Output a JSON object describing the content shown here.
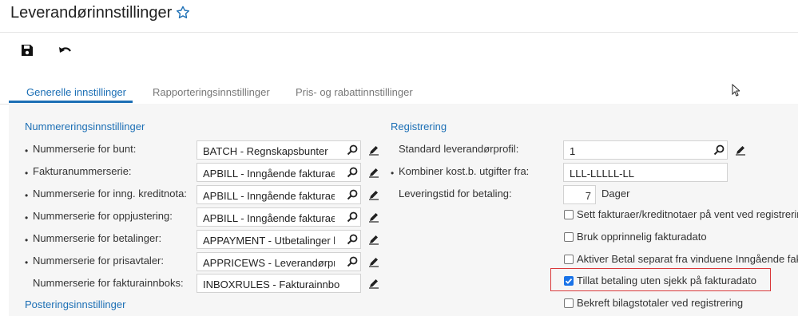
{
  "title": "Leverandørinnstillinger",
  "tabs": [
    {
      "label": "Generelle innstillinger"
    },
    {
      "label": "Rapporteringsinnstillinger"
    },
    {
      "label": "Pris- og rabattinnstillinger"
    }
  ],
  "left": {
    "section_title": "Nummereringsinnstillinger",
    "rows": [
      {
        "label": "Nummerserie for bunt:",
        "value": "BATCH - Regnskapsbunter"
      },
      {
        "label": "Fakturanummerserie:",
        "value": "APBILL - Inngående fakturaer"
      },
      {
        "label": "Nummerserie for inng. kreditnota:",
        "value": "APBILL - Inngående fakturaer"
      },
      {
        "label": "Nummerserie for oppjustering:",
        "value": "APBILL - Inngående fakturaer"
      },
      {
        "label": "Nummerserie for betalinger:",
        "value": "APPAYMENT - Utbetalinger leverandør"
      },
      {
        "label": "Nummerserie for prisavtaler:",
        "value": "APPRICEWS - Leverandørprisavtaler"
      },
      {
        "label": "Nummerserie for fakturainnboks:",
        "value": "INBOXRULES - Fakturainnboks"
      }
    ],
    "section2_title": "Posteringsinnstillinger"
  },
  "right": {
    "section_title": "Registrering",
    "profile_label": "Standard leverandørprofil:",
    "profile_value": "1",
    "mask_label": "Kombiner kost.b. utgifter fra:",
    "mask_value": "LLL-LLLLL-LL",
    "lead_label": "Leveringstid for betaling:",
    "lead_value": "7",
    "lead_unit": "Dager",
    "checkboxes": [
      {
        "label": "Sett fakturaer/kreditnotaer på vent ved registrering",
        "checked": false
      },
      {
        "label": "Bruk opprinnelig fakturadato",
        "checked": false
      },
      {
        "label": "Aktiver Betal separat fra vinduene Inngående faktu",
        "checked": false
      },
      {
        "label": "Tillat betaling uten sjekk på fakturadato",
        "checked": true
      },
      {
        "label": "Bekreft bilagstotaler ved registrering",
        "checked": false
      }
    ]
  },
  "icons": {
    "favorite": "star-outline-icon",
    "save": "floppy-disk-icon",
    "undo": "undo-arrow-icon",
    "search": "magnifier-icon",
    "edit": "pencil-icon"
  },
  "colors": {
    "accent": "#1c6fb5",
    "highlight": "#d9383a",
    "checkbox_on": "#1a73e8"
  }
}
